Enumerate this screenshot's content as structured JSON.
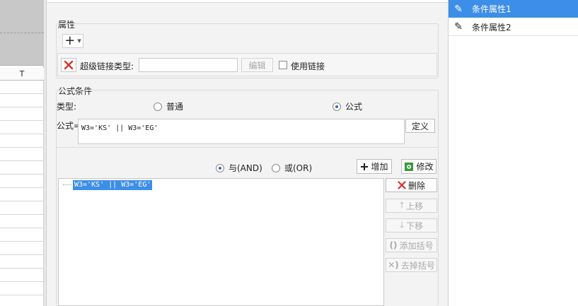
{
  "sheet": {
    "column_header": "T"
  },
  "attributes": {
    "section_title": "属性",
    "add_symbol": "+",
    "hyperlink_type_label": "超级链接类型:",
    "hyperlink_type_value": "",
    "edit_label": "编辑",
    "use_link_label": "使用链接"
  },
  "formula_condition": {
    "section_title": "公式条件",
    "type_label": "类型:",
    "type_options": [
      {
        "label": "普通",
        "selected": false
      },
      {
        "label": "公式",
        "selected": true
      }
    ],
    "formula_label": "公式=",
    "formula_value": "W3='KS' || W3='EG'",
    "define_label": "定义",
    "logic_options": [
      {
        "label": "与(AND)",
        "selected": true
      },
      {
        "label": "或(OR)",
        "selected": false
      }
    ],
    "add_label": "增加",
    "modify_label": "修改",
    "condition_list": [
      "W3='KS' || W3='EG'"
    ],
    "delete_label": "删除",
    "move_up_label": "上移",
    "move_down_label": "下移",
    "add_bracket_label": "添加括号",
    "remove_bracket_label": "去掉括号"
  },
  "condition_attributes": [
    {
      "label": "条件属性1",
      "selected": true
    },
    {
      "label": "条件属性2",
      "selected": false
    }
  ],
  "colors": {
    "selected_bg": "#3d8ee8",
    "highlight_bg": "#3d8ee8",
    "delete_red": "#d9322b",
    "modify_green": "#3a9a3a"
  }
}
